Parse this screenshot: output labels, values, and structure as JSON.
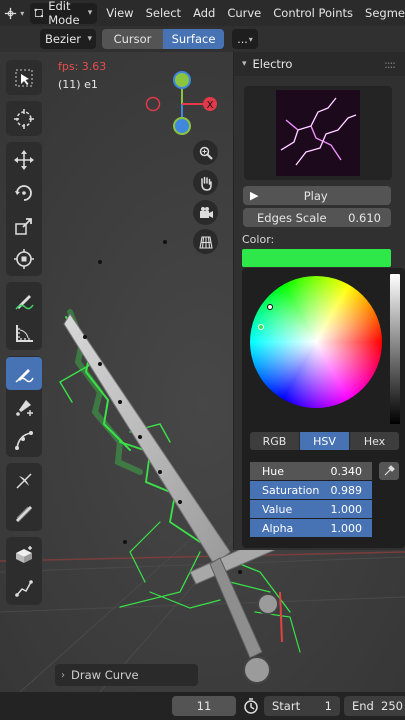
{
  "header": {
    "mode": "Edit Mode",
    "menu": [
      "View",
      "Select",
      "Add",
      "Curve",
      "Control Points",
      "Segme"
    ]
  },
  "tool_header": {
    "curve_type": "Bezier",
    "depth_options": [
      "Cursor",
      "Surface"
    ],
    "depth_selected": "Surface",
    "more": "..."
  },
  "viewport": {
    "fps": "fps: 3.63",
    "object": "(11) e1",
    "operator_panel": "Draw Curve"
  },
  "gizmo": {
    "x_label": "X",
    "colors": {
      "x": "#e23a4a",
      "y": "#8bc53f",
      "z": "#3f88dd"
    }
  },
  "toolbar": {
    "active_tool": "draw-tool",
    "tools": [
      "select-box-icon",
      "cursor-icon",
      "move-icon",
      "rotate-icon",
      "scale-icon",
      "transform-icon",
      "annotate-icon",
      "measure-icon",
      "draw-icon",
      "pen-icon",
      "curve-edit-icon",
      "tilt-icon",
      "radius-icon",
      "extrude-icon",
      "randomize-icon"
    ]
  },
  "panel": {
    "title": "Electro",
    "play_label": "Play",
    "edges_label": "Edges Scale",
    "edges_value": "0.610",
    "color_label": "Color:",
    "color_value": "#2ee84a"
  },
  "picker": {
    "tabs": [
      "RGB",
      "HSV",
      "Hex"
    ],
    "selected_tab": "HSV",
    "fields": [
      {
        "label": "Hue",
        "value": "0.340"
      },
      {
        "label": "Saturation",
        "value": "0.989"
      },
      {
        "label": "Value",
        "value": "1.000"
      },
      {
        "label": "Alpha",
        "value": "1.000"
      }
    ]
  },
  "timeline": {
    "current_frame": "11",
    "start_label": "Start",
    "start_value": "1",
    "end_label": "End",
    "end_value": "250"
  }
}
